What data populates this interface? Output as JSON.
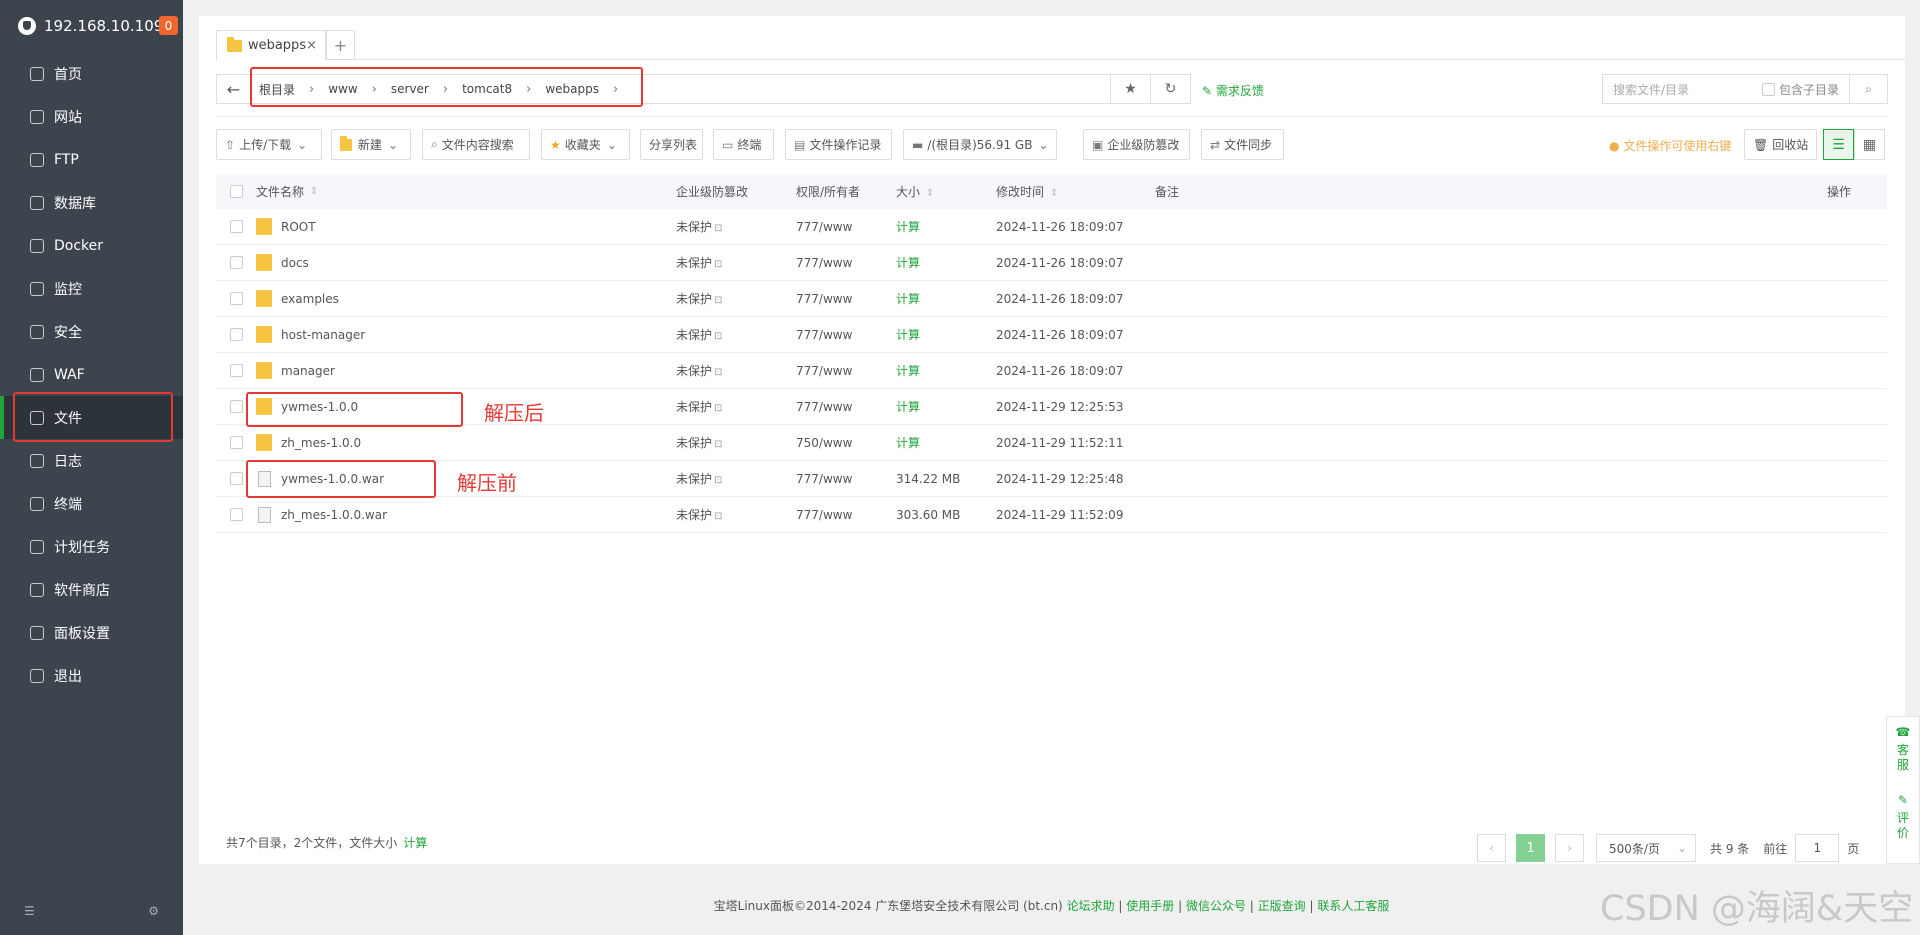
{
  "sidebar": {
    "host": "192.168.10.109",
    "badge": "0",
    "items": [
      {
        "label": "首页",
        "icon": "home-icon"
      },
      {
        "label": "网站",
        "icon": "globe-icon"
      },
      {
        "label": "FTP",
        "icon": "ftp-icon"
      },
      {
        "label": "数据库",
        "icon": "database-icon"
      },
      {
        "label": "Docker",
        "icon": "docker-icon"
      },
      {
        "label": "监控",
        "icon": "monitor-icon"
      },
      {
        "label": "安全",
        "icon": "shield-icon"
      },
      {
        "label": "WAF",
        "icon": "waf-icon"
      },
      {
        "label": "文件",
        "icon": "folder-icon"
      },
      {
        "label": "日志",
        "icon": "log-icon"
      },
      {
        "label": "终端",
        "icon": "terminal-icon"
      },
      {
        "label": "计划任务",
        "icon": "clock-icon"
      },
      {
        "label": "软件商店",
        "icon": "store-icon"
      },
      {
        "label": "面板设置",
        "icon": "settings-icon"
      },
      {
        "label": "退出",
        "icon": "logout-icon"
      }
    ],
    "active_index": 8
  },
  "tabs": {
    "current": "webapps",
    "close": "×",
    "add": "+"
  },
  "path": {
    "crumbs": [
      "根目录",
      "www",
      "server",
      "tomcat8",
      "webapps"
    ],
    "feedback": "需求反馈"
  },
  "search": {
    "placeholder": "搜索文件/目录",
    "include_sub": "包含子目录"
  },
  "toolbar": {
    "upload": "上传/下载",
    "new": "新建",
    "content_search": "文件内容搜索",
    "favorites": "收藏夹",
    "share_list": "分享列表",
    "terminal": "终端",
    "op_log": "文件操作记录",
    "disk": "/(根目录)56.91 GB",
    "tamper": "企业级防篡改",
    "sync": "文件同步",
    "tip": "文件操作可使用右键",
    "recycle": "回收站"
  },
  "table": {
    "headers": {
      "name": "文件名称",
      "protect": "企业级防篡改",
      "perm": "权限/所有者",
      "size": "大小",
      "time": "修改时间",
      "note": "备注",
      "op": "操作"
    },
    "rows": [
      {
        "name": "ROOT",
        "type": "folder",
        "protect": "未保护",
        "perm": "777/www",
        "size": "计算",
        "time": "2024-11-26 18:09:07"
      },
      {
        "name": "docs",
        "type": "folder",
        "protect": "未保护",
        "perm": "777/www",
        "size": "计算",
        "time": "2024-11-26 18:09:07"
      },
      {
        "name": "examples",
        "type": "folder",
        "protect": "未保护",
        "perm": "777/www",
        "size": "计算",
        "time": "2024-11-26 18:09:07"
      },
      {
        "name": "host-manager",
        "type": "folder",
        "protect": "未保护",
        "perm": "777/www",
        "size": "计算",
        "time": "2024-11-26 18:09:07"
      },
      {
        "name": "manager",
        "type": "folder",
        "protect": "未保护",
        "perm": "777/www",
        "size": "计算",
        "time": "2024-11-26 18:09:07"
      },
      {
        "name": "ywmes-1.0.0",
        "type": "folder",
        "protect": "未保护",
        "perm": "777/www",
        "size": "计算",
        "time": "2024-11-29 12:25:53"
      },
      {
        "name": "zh_mes-1.0.0",
        "type": "folder",
        "protect": "未保护",
        "perm": "750/www",
        "size": "计算",
        "time": "2024-11-29 11:52:11"
      },
      {
        "name": "ywmes-1.0.0.war",
        "type": "file",
        "protect": "未保护",
        "perm": "777/www",
        "size": "314.22 MB",
        "time": "2024-11-29 12:25:48"
      },
      {
        "name": "zh_mes-1.0.0.war",
        "type": "file",
        "protect": "未保护",
        "perm": "777/www",
        "size": "303.60 MB",
        "time": "2024-11-29 11:52:09"
      }
    ]
  },
  "annotations": {
    "after": "解压后",
    "before": "解压前"
  },
  "summary": {
    "text": "共7个目录，2个文件，文件大小",
    "calc": "计算"
  },
  "pager": {
    "current": "1",
    "per_page": "500条/页",
    "total": "共 9 条",
    "goto": "前往",
    "page_input": "1",
    "page_unit": "页"
  },
  "footer": {
    "copyright": "宝塔Linux面板©2014-2024 广东堡塔安全技术有限公司 (bt.cn)",
    "links": [
      "论坛求助",
      "使用手册",
      "微信公众号",
      "正版查询",
      "联系人工客服"
    ]
  },
  "float": {
    "service": "客服",
    "review": "评价"
  },
  "watermark": "CSDN @海阔&天空",
  "colors": {
    "accent": "#20a53a",
    "sidebar": "#3c444d",
    "annotation": "#e53935"
  }
}
